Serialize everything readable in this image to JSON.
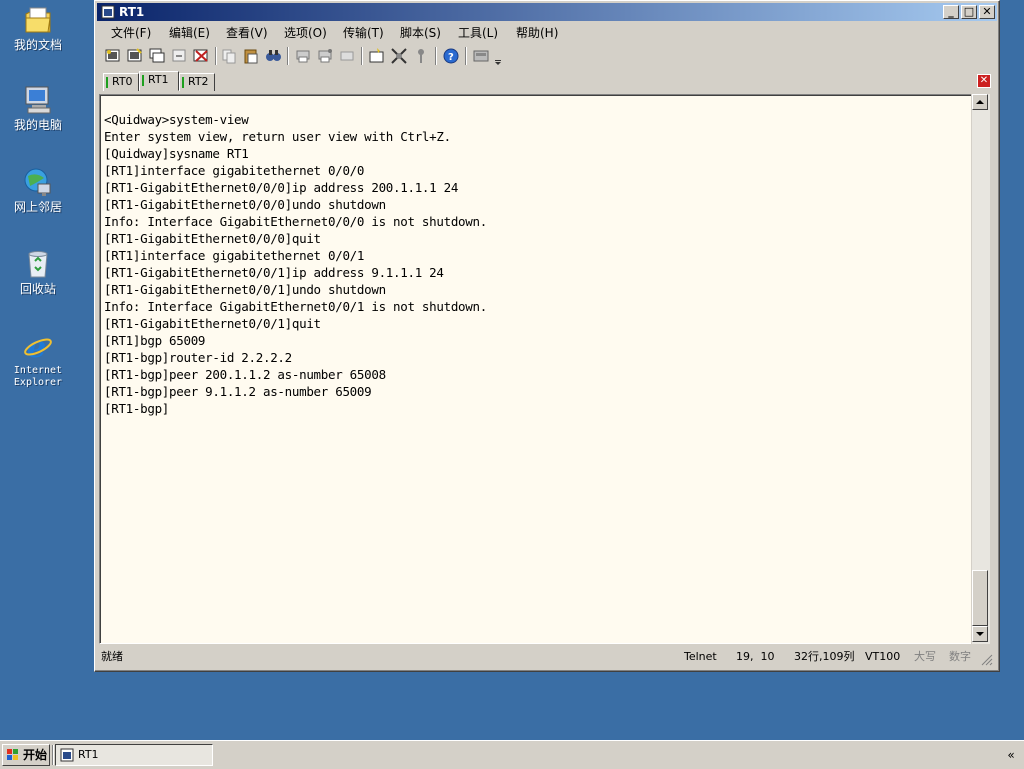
{
  "desktop": {
    "icons": [
      {
        "label": "我的文档",
        "icon": "my-documents-icon"
      },
      {
        "label": "我的电脑",
        "icon": "my-computer-icon"
      },
      {
        "label": "网上邻居",
        "icon": "network-places-icon"
      },
      {
        "label": "回收站",
        "icon": "recycle-bin-icon"
      },
      {
        "label": "Internet Explorer",
        "icon": "internet-explorer-icon"
      }
    ]
  },
  "window": {
    "title": "RT1",
    "menu": [
      "文件(F)",
      "编辑(E)",
      "查看(V)",
      "选项(O)",
      "传输(T)",
      "脚本(S)",
      "工具(L)",
      "帮助(H)"
    ],
    "tabs": [
      "RT0",
      "RT1",
      "RT2"
    ],
    "active_tab": "RT1",
    "terminal_lines": [
      "<Quidway>system-view",
      "Enter system view, return user view with Ctrl+Z.",
      "[Quidway]sysname RT1",
      "[RT1]interface gigabitethernet 0/0/0",
      "[RT1-GigabitEthernet0/0/0]ip address 200.1.1.1 24",
      "[RT1-GigabitEthernet0/0/0]undo shutdown",
      "Info: Interface GigabitEthernet0/0/0 is not shutdown.",
      "[RT1-GigabitEthernet0/0/0]quit",
      "[RT1]interface gigabitethernet 0/0/1",
      "[RT1-GigabitEthernet0/0/1]ip address 9.1.1.1 24",
      "[RT1-GigabitEthernet0/0/1]undo shutdown",
      "Info: Interface GigabitEthernet0/0/1 is not shutdown.",
      "[RT1-GigabitEthernet0/0/1]quit",
      "[RT1]bgp 65009",
      "[RT1-bgp]router-id 2.2.2.2",
      "[RT1-bgp]peer 200.1.1.2 as-number 65008",
      "[RT1-bgp]peer 9.1.1.2 as-number 65009",
      "[RT1-bgp]"
    ],
    "status": {
      "ready": "就绪",
      "protocol": "Telnet",
      "cursor_pos": "19,  10",
      "size": "32行,109列",
      "terminal_type": "VT100",
      "caps": "大写",
      "num": "数字"
    }
  },
  "taskbar": {
    "start_label": "开始",
    "task_label": "RT1",
    "tray_label": "«"
  }
}
